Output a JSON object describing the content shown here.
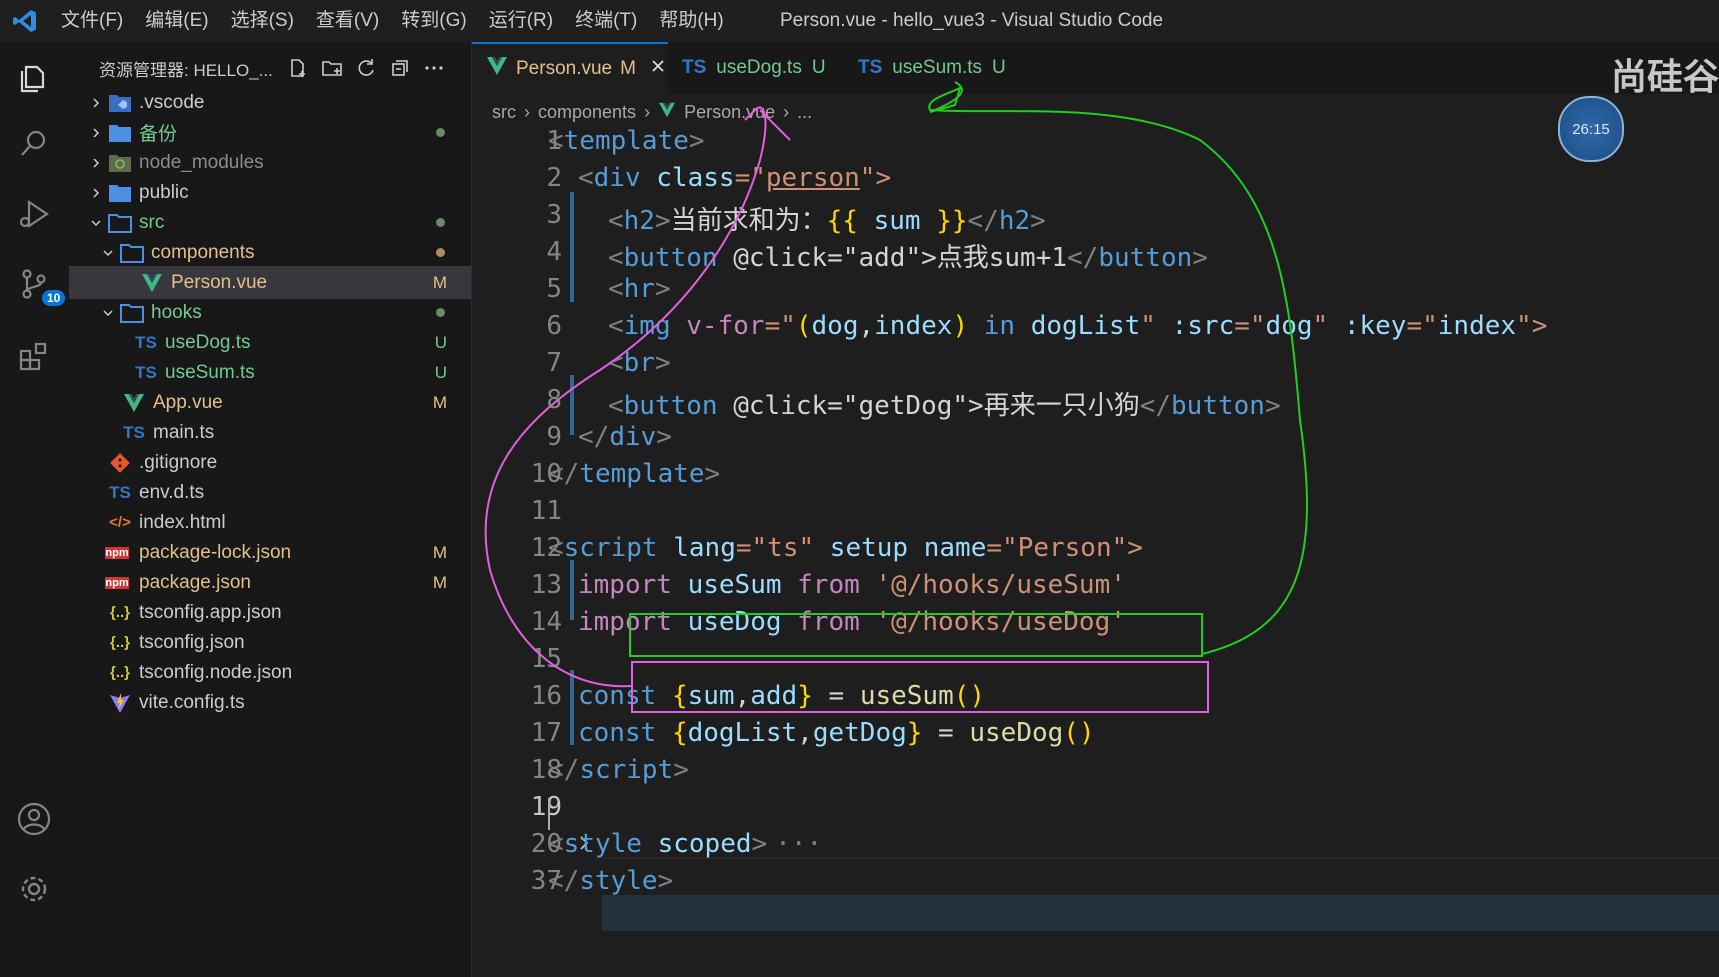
{
  "window": {
    "menu": [
      "文件(F)",
      "编辑(E)",
      "选择(S)",
      "查看(V)",
      "转到(G)",
      "运行(R)",
      "终端(T)",
      "帮助(H)"
    ],
    "title": "Person.vue - hello_vue3 - Visual Studio Code"
  },
  "activity": {
    "scm_badge": "10"
  },
  "explorer": {
    "title": "资源管理器: HELLO_...",
    "items": [
      {
        "name": ".vscode",
        "icon": "vscode-folder-icon",
        "status": ""
      },
      {
        "name": "备份",
        "icon": "folder-icon",
        "status": "dot"
      },
      {
        "name": "node_modules",
        "icon": "node-folder-icon",
        "status": ""
      },
      {
        "name": "public",
        "icon": "folder-icon",
        "status": ""
      },
      {
        "name": "src",
        "icon": "folder-icon",
        "status": "dot"
      },
      {
        "name": "components",
        "icon": "folder-icon",
        "status": "dot"
      },
      {
        "name": "Person.vue",
        "icon": "vue-icon",
        "status": "M"
      },
      {
        "name": "hooks",
        "icon": "folder-icon",
        "status": "dot"
      },
      {
        "name": "useDog.ts",
        "icon": "ts-icon",
        "status": "U"
      },
      {
        "name": "useSum.ts",
        "icon": "ts-icon",
        "status": "U"
      },
      {
        "name": "App.vue",
        "icon": "vue-icon",
        "status": "M"
      },
      {
        "name": "main.ts",
        "icon": "ts-icon",
        "status": ""
      },
      {
        "name": ".gitignore",
        "icon": "git-icon",
        "status": ""
      },
      {
        "name": "env.d.ts",
        "icon": "ts-icon",
        "status": ""
      },
      {
        "name": "index.html",
        "icon": "html-icon",
        "status": ""
      },
      {
        "name": "package-lock.json",
        "icon": "npm-icon",
        "status": "M"
      },
      {
        "name": "package.json",
        "icon": "npm-icon",
        "status": "M"
      },
      {
        "name": "tsconfig.app.json",
        "icon": "json-icon",
        "status": ""
      },
      {
        "name": "tsconfig.json",
        "icon": "json-icon",
        "status": ""
      },
      {
        "name": "tsconfig.node.json",
        "icon": "json-icon",
        "status": ""
      },
      {
        "name": "vite.config.ts",
        "icon": "vite-icon",
        "status": ""
      }
    ],
    "ts_label": "TS",
    "json_label": "{..}",
    "npm_label": "npm",
    "html_label": "</>"
  },
  "tabs": [
    {
      "label": "Person.vue",
      "status": "M",
      "type": "vue"
    },
    {
      "label": "useDog.ts",
      "status": "U",
      "type": "ts"
    },
    {
      "label": "useSum.ts",
      "status": "U",
      "type": "ts"
    }
  ],
  "brand": "尚硅谷",
  "breadcrumb": [
    "src",
    "components",
    "Person.vue",
    "..."
  ],
  "timer": "26:15",
  "line_numbers": [
    "1",
    "2",
    "3",
    "4",
    "5",
    "6",
    "7",
    "8",
    "9",
    "10",
    "11",
    "12",
    "13",
    "14",
    "15",
    "16",
    "17",
    "18",
    "19",
    "20",
    "37"
  ],
  "code": {
    "l1": [
      "<",
      "template",
      ">"
    ],
    "l2": [
      "<",
      "div",
      "class",
      "=\"",
      "person",
      "\">"
    ],
    "l3": [
      "<",
      "h2",
      ">",
      "当前求和为：",
      "{{",
      " sum ",
      "}}",
      "</",
      "h2",
      ">"
    ],
    "l4": [
      "<",
      "button",
      "@click",
      "=\"",
      "add",
      "\">",
      "点我sum+1",
      "</",
      "button",
      ">"
    ],
    "l5": [
      "<",
      "hr",
      ">"
    ],
    "l6": [
      "<",
      "img",
      "v-for",
      "=\"",
      "(",
      "dog",
      ",",
      "index",
      ")",
      " in ",
      "dogList",
      "\"",
      ":src",
      "=\"",
      "dog",
      "\"",
      ":key",
      "=\"",
      "index",
      "\">"
    ],
    "l7": [
      "<",
      "br",
      ">"
    ],
    "l8": [
      "<",
      "button",
      "@click",
      "=\"",
      "getDog",
      "\">",
      "再来一只小狗",
      "</",
      "button",
      ">"
    ],
    "l9": [
      "</",
      "div",
      ">"
    ],
    "l10": [
      "</",
      "template",
      ">"
    ],
    "l12": [
      "<",
      "script",
      "lang",
      "=\"",
      "ts",
      "\"",
      "setup",
      "name",
      "=\"",
      "Person",
      "\">"
    ],
    "l13": [
      "import",
      " useSum ",
      "from",
      " '@/hooks/useSum'"
    ],
    "l14": [
      "import",
      " useDog ",
      "from",
      " '@/hooks/useDog'"
    ],
    "l16": [
      "const",
      "{",
      "sum",
      ",",
      "add",
      "}",
      " = ",
      "useSum",
      "()"
    ],
    "l17": [
      "const",
      "{",
      "dogList",
      ",",
      "getDog",
      "}",
      " = ",
      "useDog",
      "()"
    ],
    "l18": [
      "</",
      "script",
      ">"
    ],
    "l20": [
      "<",
      "style",
      " scoped",
      ">",
      "···"
    ],
    "l37": [
      "</",
      "style",
      ">"
    ]
  },
  "colors": {
    "accent": "#0078d4",
    "vue_green": "#41b883",
    "ts_blue": "#3178c6",
    "modified": "#e2c08d",
    "untracked": "#73c991",
    "annot_green": "#22cc22",
    "annot_pink": "#e060e0"
  }
}
